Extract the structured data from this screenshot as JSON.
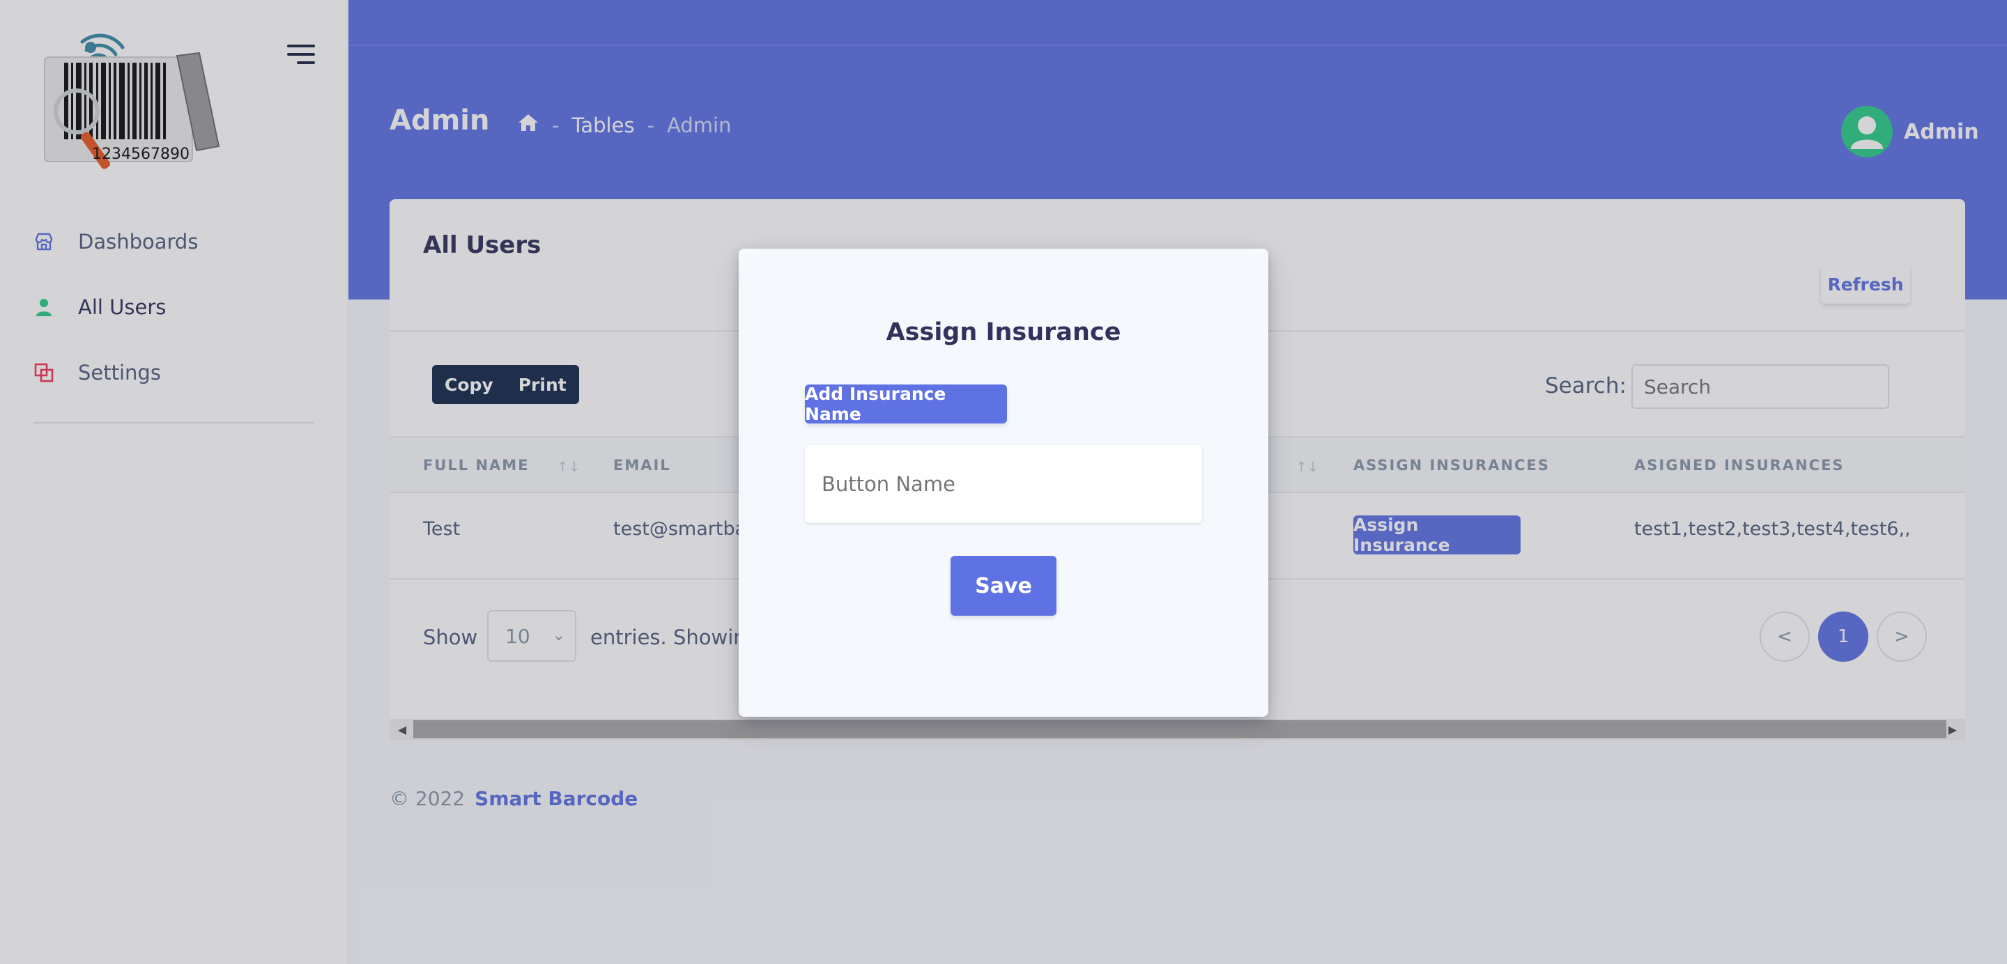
{
  "app": {
    "title": "Admin"
  },
  "sidebar": {
    "logo_text": "1234567890",
    "items": [
      {
        "label": "Dashboards",
        "icon": "shop-icon",
        "color": "#5e72e4"
      },
      {
        "label": "All Users",
        "icon": "user-icon",
        "color": "#2dce89"
      },
      {
        "label": "Settings",
        "icon": "copy-icon",
        "color": "#f5365c"
      }
    ]
  },
  "header": {
    "title": "Admin",
    "breadcrumb": {
      "home_icon": "home-icon",
      "sep": "-",
      "items": [
        "Tables",
        "Admin"
      ]
    },
    "user": {
      "name": "Admin"
    }
  },
  "card": {
    "title": "All Users",
    "refresh_label": "Refresh",
    "export": {
      "copy": "Copy",
      "print": "Print"
    },
    "search": {
      "label": "Search:",
      "placeholder": "Search"
    },
    "columns": [
      "FULL NAME",
      "EMAIL",
      "ASSIGN INSURANCES",
      "ASIGNED INSURANCES"
    ],
    "rows": [
      {
        "full_name": "Test",
        "email": "test@smartbar",
        "action": "Assign Insurance",
        "assigned": "test1,test2,test3,test4,test6,,"
      }
    ],
    "footer": {
      "show": "Show",
      "page_size": "10",
      "entries_text": "entries. Showing",
      "pager": {
        "prev": "<",
        "current": "1",
        "next": ">"
      }
    }
  },
  "footer": {
    "copyright": "© 2022",
    "brand": "Smart Barcode"
  },
  "modal": {
    "title": "Assign Insurance",
    "add_button": "Add Insurance Name",
    "input_placeholder": "Button Name",
    "save_button": "Save"
  },
  "colors": {
    "primary": "#5e72e4",
    "dark": "#172b4d",
    "success": "#2dce89",
    "danger": "#f5365c"
  }
}
